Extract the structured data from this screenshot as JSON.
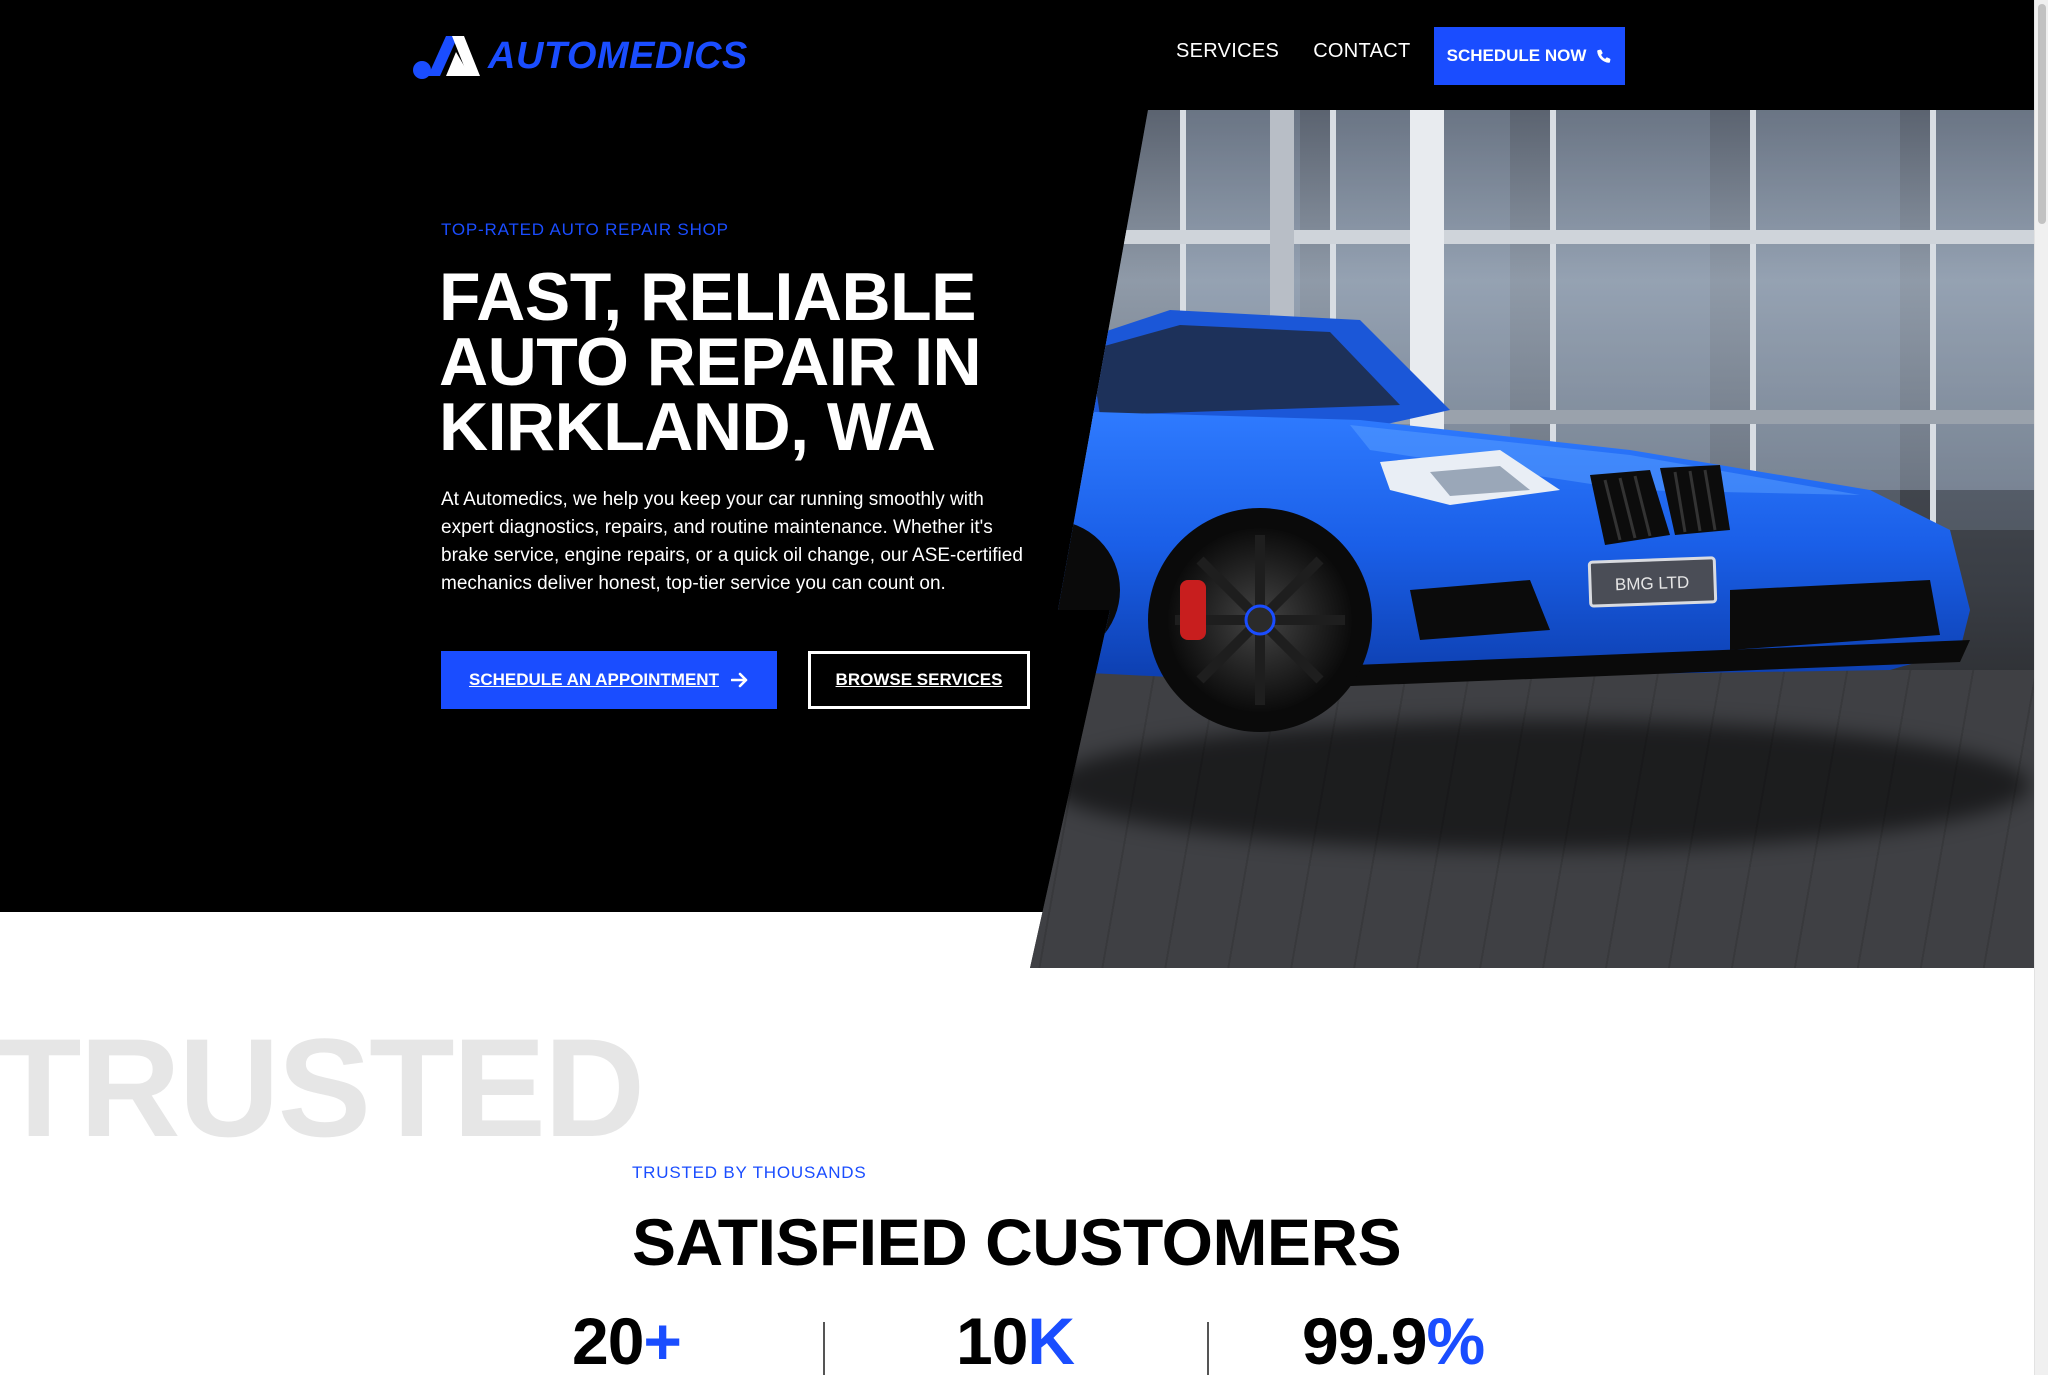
{
  "header": {
    "logo_text": "AUTOMEDICS",
    "nav": [
      "SERVICES",
      "CONTACT"
    ],
    "cta_label": "SCHEDULE NOW"
  },
  "hero": {
    "eyebrow": "TOP-RATED AUTO REPAIR SHOP",
    "title": "FAST, RELIABLE AUTO REPAIR IN KIRKLAND, WA",
    "description": "At Automedics, we help you keep your car running smoothly with expert diagnostics, repairs, and routine maintenance. Whether it's brake service, engine repairs, or a quick oil change, our ASE-certified mechanics deliver honest, top-tier service you can count on.",
    "primary_button": "SCHEDULE AN APPOINTMENT",
    "secondary_button": "BROWSE SERVICES",
    "plate_text": "BMG LTD"
  },
  "trusted": {
    "watermark": "TRUSTED",
    "eyebrow": "TRUSTED BY THOUSANDS",
    "title": "SATISFIED CUSTOMERS",
    "stats": [
      {
        "value": "20",
        "suffix": "+"
      },
      {
        "value": "10",
        "suffix": "K"
      },
      {
        "value": "99.9",
        "suffix": "%"
      }
    ]
  },
  "colors": {
    "accent": "#1a4dff",
    "hero_bg": "#000000",
    "watermark": "#e6e6e6"
  },
  "icons": [
    "phone-icon",
    "arrow-right-icon",
    "logo-mark-icon"
  ]
}
